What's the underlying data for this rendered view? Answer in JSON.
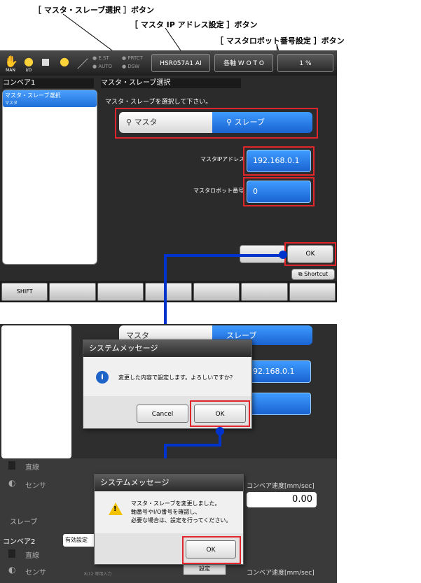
{
  "callouts": {
    "master_slave": "［ マスタ・スレーブ選択 ］ボタン",
    "master_ip": "［ マスタ IP アドレス設定 ］ボタン",
    "master_robot": "［ マスタロボット番号設定 ］ボタン"
  },
  "screen1": {
    "lamps": [
      "E.ST",
      "AUTO",
      "PRTCT",
      "DSW"
    ],
    "icon_labels": [
      "MAN",
      "I/O"
    ],
    "robot_button": "HSR057A1 AI",
    "axis_button": "各軸 W O T O",
    "speed": "1 %",
    "left_header": "コンベア1",
    "right_header": "マスタ・スレーブ選択",
    "list_item": "マスタ・スレーブ選択",
    "list_item_sub": "マスタ",
    "instruction": "マスタ・スレーブを選択して下さい。",
    "seg_master": "マスタ",
    "seg_slave": "スレーブ",
    "ip_label": "マスタIPアドレス",
    "ip_value": "192.168.0.1",
    "robot_label": "マスタロボット番号",
    "robot_value": "0",
    "ok": "OK",
    "shortcut": "Shortcut",
    "shift": "SHIFT"
  },
  "dialog1": {
    "title": "システムメッセージ",
    "message": "変更した内容で設定します。よろしいですか？",
    "cancel": "Cancel",
    "ok": "OK",
    "bg_master": "マスタ",
    "bg_slave": "スレーブ",
    "bg_ip": "92.168.0.1"
  },
  "dialog2": {
    "title": "システムメッセージ",
    "message_lines": [
      "マスタ・スレーブを変更しました。",
      "軸番号やI/O番号を確認し、",
      "必要な場合は、設定を行ってください。"
    ],
    "ok": "OK",
    "bg_line": "直線",
    "bg_sensor": "センサ",
    "bg_speed_label": "コンベア速度[mm/sec]",
    "bg_speed_value": "0.00",
    "bg_slave": "スレーブ",
    "bg_conveyor2": "コンベア2",
    "bg_valid": "有効設定",
    "bg_line2": "直線",
    "bg_sensor2": "センサ",
    "bg_speed_label2": "コンベア速度[mm/sec]",
    "bg_small": "8/12 専用入力",
    "bg_setting": "設定"
  },
  "colors": {
    "accent": "#1f6fd8",
    "highlight": "#e0262a",
    "flow": "#0033cc"
  }
}
